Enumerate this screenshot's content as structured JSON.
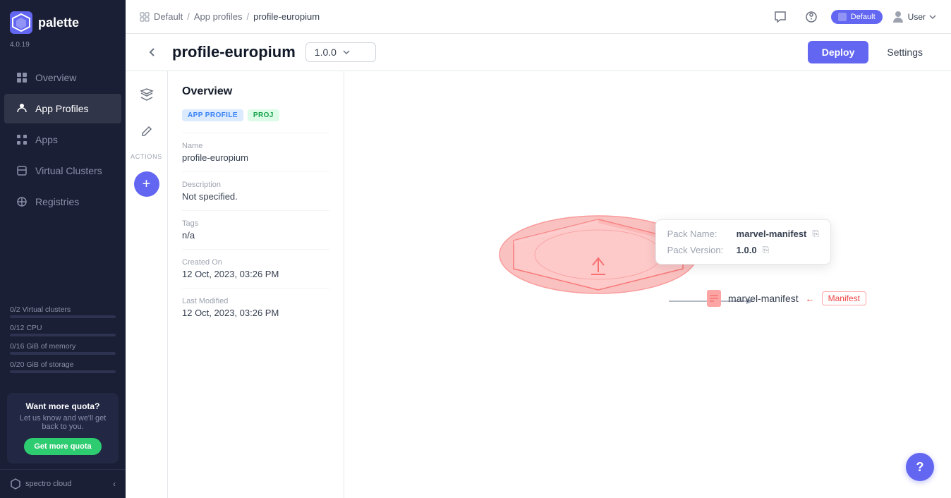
{
  "app": {
    "name": "palette",
    "version": "4.0.19"
  },
  "sidebar": {
    "nav_items": [
      {
        "id": "overview",
        "label": "Overview",
        "active": false
      },
      {
        "id": "app-profiles",
        "label": "App Profiles",
        "active": true
      },
      {
        "id": "apps",
        "label": "Apps",
        "active": false
      },
      {
        "id": "virtual-clusters",
        "label": "Virtual Clusters",
        "active": false
      },
      {
        "id": "registries",
        "label": "Registries",
        "active": false
      }
    ],
    "quota": {
      "virtual_clusters": "0/2 Virtual clusters",
      "cpu": "0/12 CPU",
      "memory": "0/16 GiB of memory",
      "storage": "0/20 GiB of storage"
    },
    "want_more": {
      "title": "Want more quota?",
      "description": "Let us know and we'll get back to you.",
      "button_label": "Get more quota"
    },
    "footer": {
      "brand": "spectro cloud"
    }
  },
  "topbar": {
    "breadcrumb": {
      "items": [
        "Default",
        "App profiles",
        "profile-europium"
      ]
    },
    "icons": [
      "chat-icon",
      "help-circle-icon"
    ]
  },
  "page": {
    "title": "profile-europium",
    "version": "1.0.0",
    "deploy_label": "Deploy",
    "settings_label": "Settings",
    "overview_title": "Overview"
  },
  "profile_info": {
    "badges": [
      "APP PROFILE",
      "PROJ"
    ],
    "name_label": "Name",
    "name_value": "profile-europium",
    "description_label": "Description",
    "description_value": "Not specified.",
    "tags_label": "Tags",
    "tags_value": "n/a",
    "created_on_label": "Created On",
    "created_on_value": "12 Oct, 2023, 03:26 PM",
    "last_modified_label": "Last Modified",
    "last_modified_value": "12 Oct, 2023, 03:26 PM"
  },
  "pack_tooltip": {
    "pack_name_label": "Pack Name:",
    "pack_name_value": "marvel-manifest",
    "pack_version_label": "Pack Version:",
    "pack_version_value": "1.0.0"
  },
  "manifest_node": {
    "name": "marvel-manifest",
    "label": "Manifest"
  },
  "help": {
    "label": "?"
  }
}
